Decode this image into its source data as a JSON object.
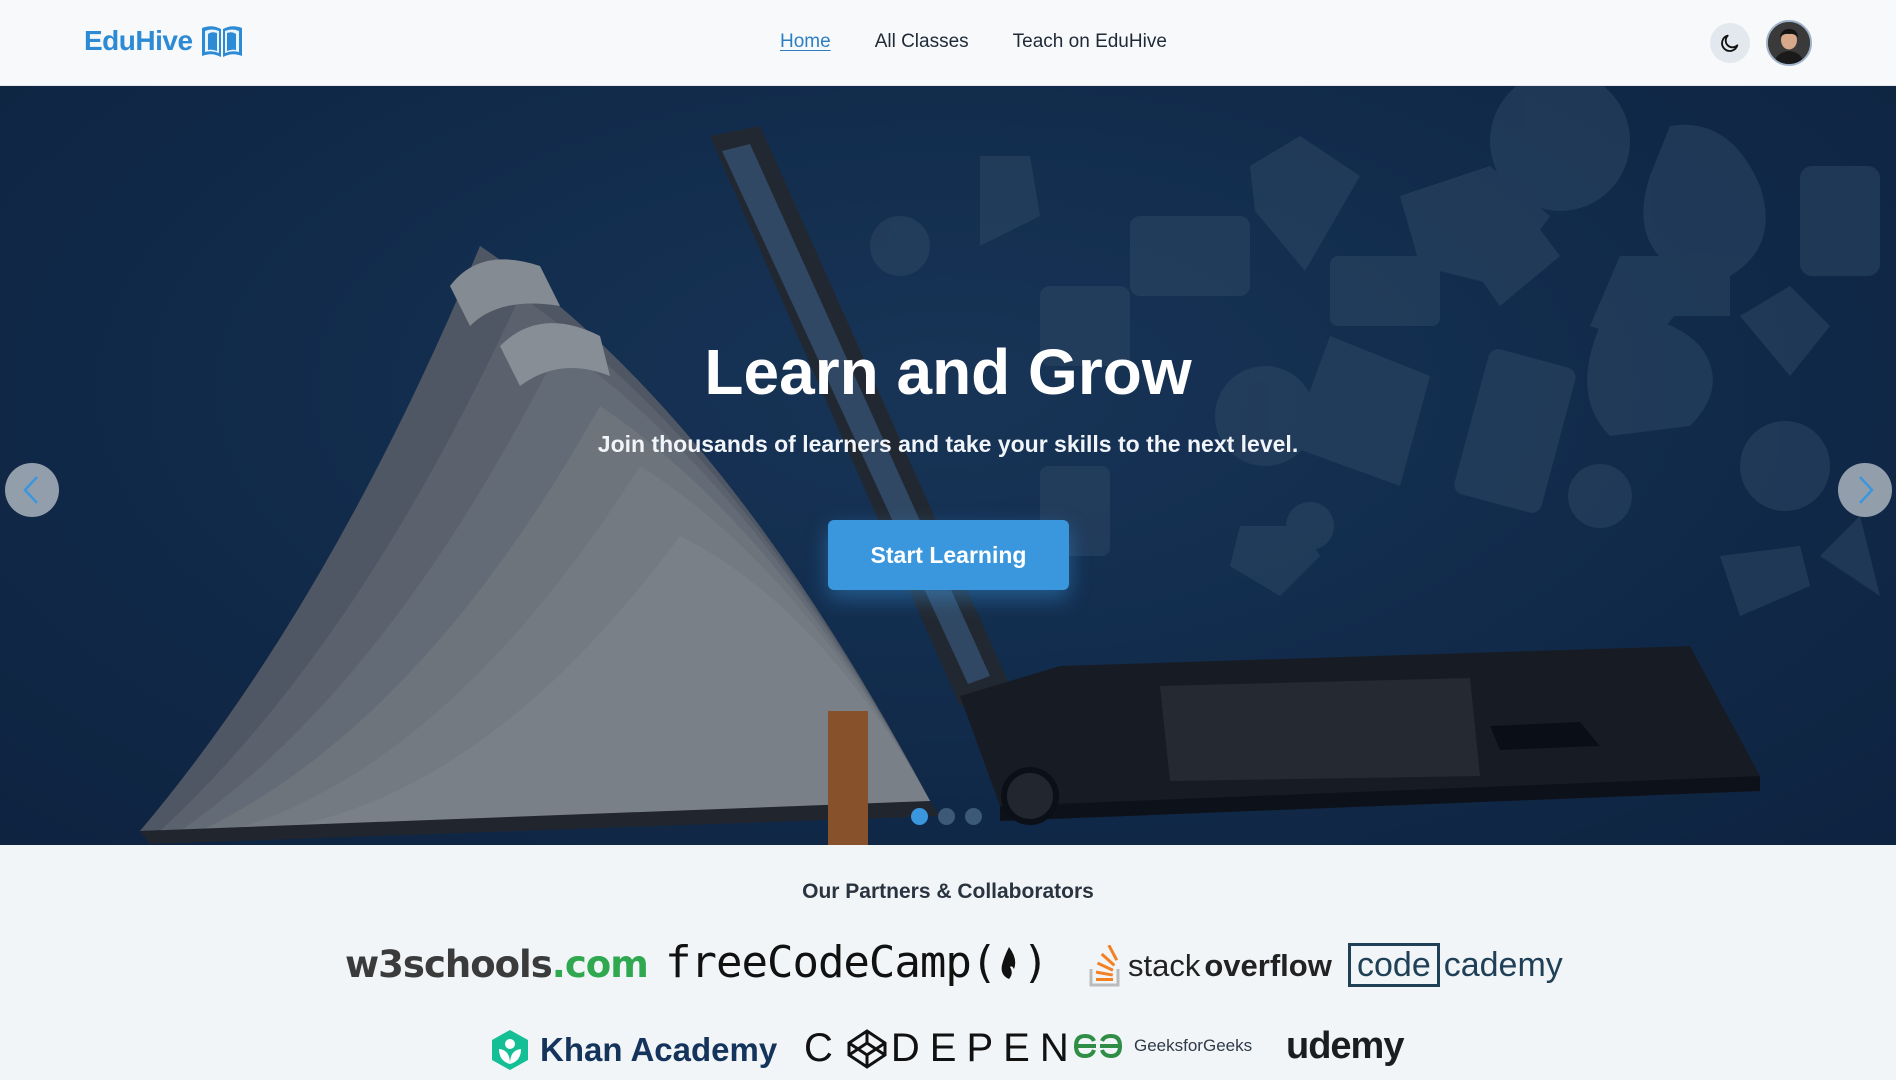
{
  "header": {
    "logo_text": "EduHive",
    "logo_icon": "open-book-icon",
    "nav": [
      {
        "label": "Home",
        "active": true
      },
      {
        "label": "All Classes",
        "active": false
      },
      {
        "label": "Teach on EduHive",
        "active": false
      }
    ],
    "theme_toggle_icon": "moon-icon",
    "avatar": "user-avatar"
  },
  "hero": {
    "title": "Learn and Grow",
    "subtitle": "Join thousands of learners and take your skills to the next level.",
    "cta_label": "Start Learning",
    "prev_icon": "chevron-left-icon",
    "next_icon": "chevron-right-icon",
    "slides_count": 3,
    "active_slide": 1
  },
  "partners": {
    "title": "Our Partners & Collaborators",
    "logos": {
      "w3schools": {
        "main": "w3schools",
        "suffix": ".com"
      },
      "freecodecamp": {
        "text": "freeCodeCamp(",
        "end": ")"
      },
      "stackoverflow": {
        "light": "stack",
        "bold": "overflow"
      },
      "codecademy": {
        "box": "code",
        "rest": "cademy"
      },
      "khan": {
        "text": "Khan Academy"
      },
      "codepen": {
        "text": "DEPEN",
        "first": "C"
      },
      "geeksforgeeks": {
        "text": "GeeksforGeeks"
      },
      "udemy": {
        "text": "udemy"
      }
    }
  },
  "colors": {
    "accent": "#3a97dd",
    "logo": "#2d8ad4",
    "hero_bg": "#16355a"
  }
}
